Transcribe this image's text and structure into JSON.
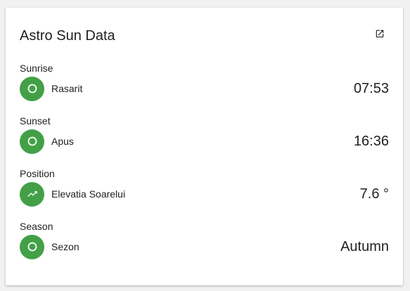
{
  "card": {
    "title": "Astro Sun Data",
    "open_icon": "open-in-new-icon"
  },
  "accent_color": "#43a047",
  "sections": [
    {
      "label": "Sunrise",
      "entity_name": "Rasarit",
      "value": "07:53",
      "icon": "circle-outline-icon"
    },
    {
      "label": "Sunset",
      "entity_name": "Apus",
      "value": "16:36",
      "icon": "circle-outline-icon"
    },
    {
      "label": "Position",
      "entity_name": "Elevatia Soarelui",
      "value": "7.6 °",
      "icon": "trending-up-icon"
    },
    {
      "label": "Season",
      "entity_name": "Sezon",
      "value": "Autumn",
      "icon": "circle-outline-icon"
    }
  ]
}
